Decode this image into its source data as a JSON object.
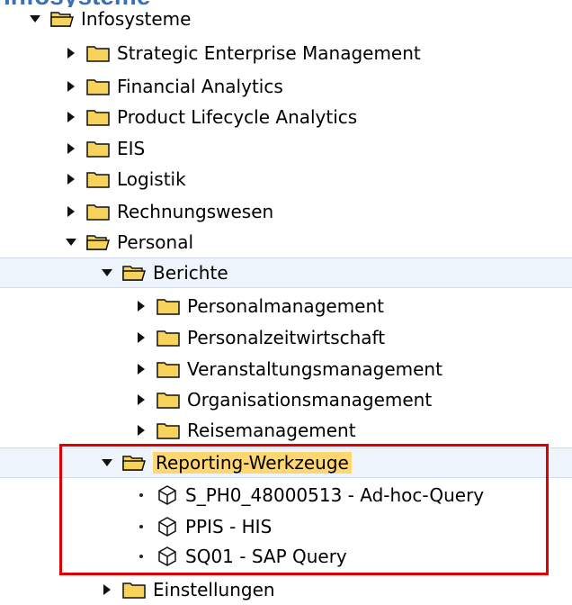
{
  "header_fragment": "Infosysteme",
  "tree": {
    "root": {
      "label": "Infosysteme",
      "expanded": true
    },
    "level1": [
      {
        "label": "Strategic Enterprise Management",
        "expanded": false
      },
      {
        "label": "Financial Analytics",
        "expanded": false
      },
      {
        "label": "Product Lifecycle Analytics",
        "expanded": false
      },
      {
        "label": "EIS",
        "expanded": false
      },
      {
        "label": "Logistik",
        "expanded": false
      },
      {
        "label": "Rechnungswesen",
        "expanded": false
      },
      {
        "label": "Personal",
        "expanded": true
      }
    ],
    "personal": {
      "berichte": {
        "label": "Berichte",
        "expanded": true
      },
      "berichte_children": [
        {
          "label": "Personalmanagement"
        },
        {
          "label": "Personalzeitwirtschaft"
        },
        {
          "label": "Veranstaltungsmanagement"
        },
        {
          "label": "Organisationsmanagement"
        },
        {
          "label": "Reisemanagement"
        }
      ],
      "reporting": {
        "label": "Reporting-Werkzeuge",
        "expanded": true,
        "selected": true
      },
      "reporting_children": [
        {
          "label": "S_PH0_48000513 - Ad-hoc-Query"
        },
        {
          "label": "PPIS - HIS"
        },
        {
          "label": "SQ01 - SAP Query"
        }
      ],
      "einstellungen": {
        "label": "Einstellungen",
        "expanded": false
      }
    }
  },
  "colors": {
    "highlight_box": "#e00000",
    "selected_bg": "#ffd770",
    "folder_fill": "#f7d35c",
    "band_bg": "#eef4fb"
  },
  "icons": {
    "expand": "triangle-right-icon",
    "collapse": "triangle-down-icon",
    "folder": "folder-icon",
    "leaf": "report-node-icon",
    "bullet": "bullet-icon"
  }
}
